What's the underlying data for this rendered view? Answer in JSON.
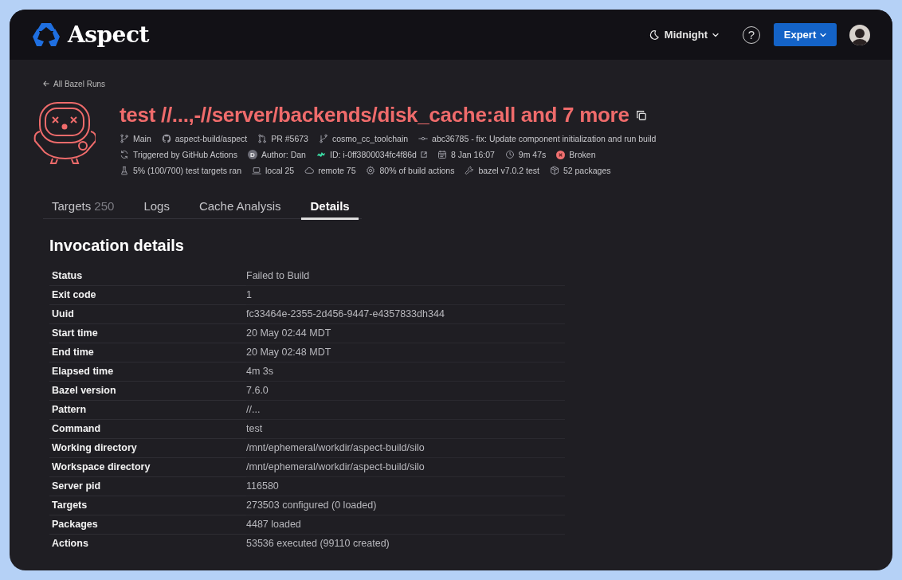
{
  "header": {
    "logo": "Aspect",
    "theme": "Midnight",
    "help": "?",
    "mode": "Expert"
  },
  "back_link": "All Bazel Runs",
  "run": {
    "title": "test //...,-//server/backends/disk_cache:all and 7 more",
    "meta_rows": [
      [
        {
          "kind": "branch",
          "text": "Main"
        },
        {
          "kind": "github",
          "text": "aspect-build/aspect"
        },
        {
          "kind": "pull-request",
          "text": "PR #5673"
        },
        {
          "kind": "fork",
          "text": "cosmo_cc_toolchain"
        },
        {
          "kind": "commit",
          "text": "abc36785 - fix: Update component initialization and run build"
        }
      ],
      [
        {
          "kind": "sync",
          "text": "Triggered by GitHub Actions"
        },
        {
          "kind": "avatar",
          "letter": "D",
          "text": "Author: Dan"
        },
        {
          "kind": "runner-link",
          "text": "ID: i-0ff3800034fc4f86d"
        },
        {
          "kind": "calendar",
          "text": "8 Jan 16:07"
        },
        {
          "kind": "clock",
          "text": "9m 47s"
        },
        {
          "kind": "status",
          "color": "#f07070",
          "text": "Broken"
        }
      ],
      [
        {
          "kind": "flask",
          "text": "5% (100/700) test targets ran"
        },
        {
          "kind": "laptop",
          "text": "local 25"
        },
        {
          "kind": "cloud",
          "text": "remote 75"
        },
        {
          "kind": "gear",
          "text": "80% of build actions"
        },
        {
          "kind": "wrench",
          "text": "bazel v7.0.2 test"
        },
        {
          "kind": "box",
          "text": "52 packages"
        }
      ]
    ]
  },
  "tabs": [
    {
      "label": "Targets",
      "count": "250",
      "selected": false
    },
    {
      "label": "Logs",
      "selected": false
    },
    {
      "label": "Cache Analysis",
      "selected": false
    },
    {
      "label": "Details",
      "selected": true
    }
  ],
  "details": {
    "heading": "Invocation details",
    "rows": [
      {
        "label": "Status",
        "value": "Failed to Build"
      },
      {
        "label": "Exit code",
        "value": "1"
      },
      {
        "label": "Uuid",
        "value": "fc33464e-2355-2d456-9447-e4357833dh344"
      },
      {
        "label": "Start time",
        "value": "20 May 02:44 MDT"
      },
      {
        "label": "End time",
        "value": "20 May 02:48 MDT"
      },
      {
        "label": "Elapsed time",
        "value": "4m 3s"
      },
      {
        "label": "Bazel version",
        "value": "7.6.0"
      },
      {
        "label": "Pattern",
        "value": "//..."
      },
      {
        "label": "Command",
        "value": "test"
      },
      {
        "label": "Working directory",
        "value": "/mnt/ephemeral/workdir/aspect-build/silo"
      },
      {
        "label": "Workspace directory",
        "value": "/mnt/ephemeral/workdir/aspect-build/silo"
      },
      {
        "label": "Server pid",
        "value": "116580"
      },
      {
        "label": "Targets",
        "value": "273503 configured (0 loaded)"
      },
      {
        "label": "Packages",
        "value": "4487 loaded"
      },
      {
        "label": "Actions",
        "value": "53536 executed (99110 created)"
      }
    ]
  }
}
